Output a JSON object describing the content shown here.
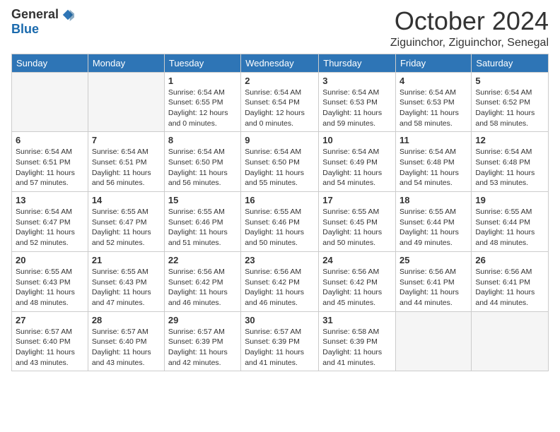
{
  "header": {
    "logo_general": "General",
    "logo_blue": "Blue",
    "month_title": "October 2024",
    "location": "Ziguinchor, Ziguinchor, Senegal"
  },
  "days_of_week": [
    "Sunday",
    "Monday",
    "Tuesday",
    "Wednesday",
    "Thursday",
    "Friday",
    "Saturday"
  ],
  "weeks": [
    [
      {
        "day": "",
        "info": ""
      },
      {
        "day": "",
        "info": ""
      },
      {
        "day": "1",
        "info": "Sunrise: 6:54 AM\nSunset: 6:55 PM\nDaylight: 12 hours and 0 minutes."
      },
      {
        "day": "2",
        "info": "Sunrise: 6:54 AM\nSunset: 6:54 PM\nDaylight: 12 hours and 0 minutes."
      },
      {
        "day": "3",
        "info": "Sunrise: 6:54 AM\nSunset: 6:53 PM\nDaylight: 11 hours and 59 minutes."
      },
      {
        "day": "4",
        "info": "Sunrise: 6:54 AM\nSunset: 6:53 PM\nDaylight: 11 hours and 58 minutes."
      },
      {
        "day": "5",
        "info": "Sunrise: 6:54 AM\nSunset: 6:52 PM\nDaylight: 11 hours and 58 minutes."
      }
    ],
    [
      {
        "day": "6",
        "info": "Sunrise: 6:54 AM\nSunset: 6:51 PM\nDaylight: 11 hours and 57 minutes."
      },
      {
        "day": "7",
        "info": "Sunrise: 6:54 AM\nSunset: 6:51 PM\nDaylight: 11 hours and 56 minutes."
      },
      {
        "day": "8",
        "info": "Sunrise: 6:54 AM\nSunset: 6:50 PM\nDaylight: 11 hours and 56 minutes."
      },
      {
        "day": "9",
        "info": "Sunrise: 6:54 AM\nSunset: 6:50 PM\nDaylight: 11 hours and 55 minutes."
      },
      {
        "day": "10",
        "info": "Sunrise: 6:54 AM\nSunset: 6:49 PM\nDaylight: 11 hours and 54 minutes."
      },
      {
        "day": "11",
        "info": "Sunrise: 6:54 AM\nSunset: 6:48 PM\nDaylight: 11 hours and 54 minutes."
      },
      {
        "day": "12",
        "info": "Sunrise: 6:54 AM\nSunset: 6:48 PM\nDaylight: 11 hours and 53 minutes."
      }
    ],
    [
      {
        "day": "13",
        "info": "Sunrise: 6:54 AM\nSunset: 6:47 PM\nDaylight: 11 hours and 52 minutes."
      },
      {
        "day": "14",
        "info": "Sunrise: 6:55 AM\nSunset: 6:47 PM\nDaylight: 11 hours and 52 minutes."
      },
      {
        "day": "15",
        "info": "Sunrise: 6:55 AM\nSunset: 6:46 PM\nDaylight: 11 hours and 51 minutes."
      },
      {
        "day": "16",
        "info": "Sunrise: 6:55 AM\nSunset: 6:46 PM\nDaylight: 11 hours and 50 minutes."
      },
      {
        "day": "17",
        "info": "Sunrise: 6:55 AM\nSunset: 6:45 PM\nDaylight: 11 hours and 50 minutes."
      },
      {
        "day": "18",
        "info": "Sunrise: 6:55 AM\nSunset: 6:44 PM\nDaylight: 11 hours and 49 minutes."
      },
      {
        "day": "19",
        "info": "Sunrise: 6:55 AM\nSunset: 6:44 PM\nDaylight: 11 hours and 48 minutes."
      }
    ],
    [
      {
        "day": "20",
        "info": "Sunrise: 6:55 AM\nSunset: 6:43 PM\nDaylight: 11 hours and 48 minutes."
      },
      {
        "day": "21",
        "info": "Sunrise: 6:55 AM\nSunset: 6:43 PM\nDaylight: 11 hours and 47 minutes."
      },
      {
        "day": "22",
        "info": "Sunrise: 6:56 AM\nSunset: 6:42 PM\nDaylight: 11 hours and 46 minutes."
      },
      {
        "day": "23",
        "info": "Sunrise: 6:56 AM\nSunset: 6:42 PM\nDaylight: 11 hours and 46 minutes."
      },
      {
        "day": "24",
        "info": "Sunrise: 6:56 AM\nSunset: 6:42 PM\nDaylight: 11 hours and 45 minutes."
      },
      {
        "day": "25",
        "info": "Sunrise: 6:56 AM\nSunset: 6:41 PM\nDaylight: 11 hours and 44 minutes."
      },
      {
        "day": "26",
        "info": "Sunrise: 6:56 AM\nSunset: 6:41 PM\nDaylight: 11 hours and 44 minutes."
      }
    ],
    [
      {
        "day": "27",
        "info": "Sunrise: 6:57 AM\nSunset: 6:40 PM\nDaylight: 11 hours and 43 minutes."
      },
      {
        "day": "28",
        "info": "Sunrise: 6:57 AM\nSunset: 6:40 PM\nDaylight: 11 hours and 43 minutes."
      },
      {
        "day": "29",
        "info": "Sunrise: 6:57 AM\nSunset: 6:39 PM\nDaylight: 11 hours and 42 minutes."
      },
      {
        "day": "30",
        "info": "Sunrise: 6:57 AM\nSunset: 6:39 PM\nDaylight: 11 hours and 41 minutes."
      },
      {
        "day": "31",
        "info": "Sunrise: 6:58 AM\nSunset: 6:39 PM\nDaylight: 11 hours and 41 minutes."
      },
      {
        "day": "",
        "info": ""
      },
      {
        "day": "",
        "info": ""
      }
    ]
  ]
}
